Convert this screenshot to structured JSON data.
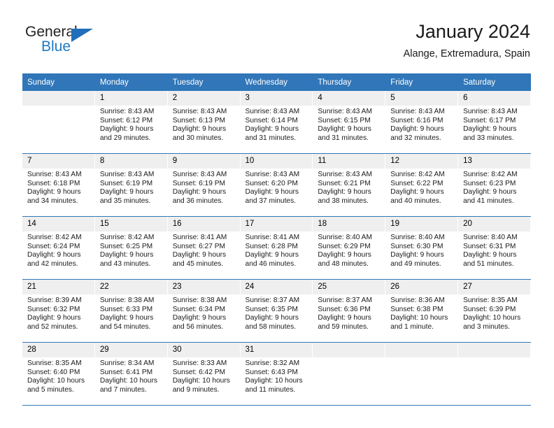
{
  "logo": {
    "word_top": "General",
    "word_bottom": "Blue",
    "triangle_color": "#1f6fba",
    "blue_color": "#1f7ac4"
  },
  "header": {
    "title": "January 2024",
    "location": "Alange, Extremadura, Spain"
  },
  "theme": {
    "header_bg": "#3076b8",
    "daynum_bg": "#efefef",
    "text": "#1a1a1a"
  },
  "weekdays": [
    "Sunday",
    "Monday",
    "Tuesday",
    "Wednesday",
    "Thursday",
    "Friday",
    "Saturday"
  ],
  "weeks": [
    [
      {
        "day": "",
        "sunrise": "",
        "sunset": "",
        "daylight1": "",
        "daylight2": ""
      },
      {
        "day": "1",
        "sunrise": "Sunrise: 8:43 AM",
        "sunset": "Sunset: 6:12 PM",
        "daylight1": "Daylight: 9 hours",
        "daylight2": "and 29 minutes."
      },
      {
        "day": "2",
        "sunrise": "Sunrise: 8:43 AM",
        "sunset": "Sunset: 6:13 PM",
        "daylight1": "Daylight: 9 hours",
        "daylight2": "and 30 minutes."
      },
      {
        "day": "3",
        "sunrise": "Sunrise: 8:43 AM",
        "sunset": "Sunset: 6:14 PM",
        "daylight1": "Daylight: 9 hours",
        "daylight2": "and 31 minutes."
      },
      {
        "day": "4",
        "sunrise": "Sunrise: 8:43 AM",
        "sunset": "Sunset: 6:15 PM",
        "daylight1": "Daylight: 9 hours",
        "daylight2": "and 31 minutes."
      },
      {
        "day": "5",
        "sunrise": "Sunrise: 8:43 AM",
        "sunset": "Sunset: 6:16 PM",
        "daylight1": "Daylight: 9 hours",
        "daylight2": "and 32 minutes."
      },
      {
        "day": "6",
        "sunrise": "Sunrise: 8:43 AM",
        "sunset": "Sunset: 6:17 PM",
        "daylight1": "Daylight: 9 hours",
        "daylight2": "and 33 minutes."
      }
    ],
    [
      {
        "day": "7",
        "sunrise": "Sunrise: 8:43 AM",
        "sunset": "Sunset: 6:18 PM",
        "daylight1": "Daylight: 9 hours",
        "daylight2": "and 34 minutes."
      },
      {
        "day": "8",
        "sunrise": "Sunrise: 8:43 AM",
        "sunset": "Sunset: 6:19 PM",
        "daylight1": "Daylight: 9 hours",
        "daylight2": "and 35 minutes."
      },
      {
        "day": "9",
        "sunrise": "Sunrise: 8:43 AM",
        "sunset": "Sunset: 6:19 PM",
        "daylight1": "Daylight: 9 hours",
        "daylight2": "and 36 minutes."
      },
      {
        "day": "10",
        "sunrise": "Sunrise: 8:43 AM",
        "sunset": "Sunset: 6:20 PM",
        "daylight1": "Daylight: 9 hours",
        "daylight2": "and 37 minutes."
      },
      {
        "day": "11",
        "sunrise": "Sunrise: 8:43 AM",
        "sunset": "Sunset: 6:21 PM",
        "daylight1": "Daylight: 9 hours",
        "daylight2": "and 38 minutes."
      },
      {
        "day": "12",
        "sunrise": "Sunrise: 8:42 AM",
        "sunset": "Sunset: 6:22 PM",
        "daylight1": "Daylight: 9 hours",
        "daylight2": "and 40 minutes."
      },
      {
        "day": "13",
        "sunrise": "Sunrise: 8:42 AM",
        "sunset": "Sunset: 6:23 PM",
        "daylight1": "Daylight: 9 hours",
        "daylight2": "and 41 minutes."
      }
    ],
    [
      {
        "day": "14",
        "sunrise": "Sunrise: 8:42 AM",
        "sunset": "Sunset: 6:24 PM",
        "daylight1": "Daylight: 9 hours",
        "daylight2": "and 42 minutes."
      },
      {
        "day": "15",
        "sunrise": "Sunrise: 8:42 AM",
        "sunset": "Sunset: 6:25 PM",
        "daylight1": "Daylight: 9 hours",
        "daylight2": "and 43 minutes."
      },
      {
        "day": "16",
        "sunrise": "Sunrise: 8:41 AM",
        "sunset": "Sunset: 6:27 PM",
        "daylight1": "Daylight: 9 hours",
        "daylight2": "and 45 minutes."
      },
      {
        "day": "17",
        "sunrise": "Sunrise: 8:41 AM",
        "sunset": "Sunset: 6:28 PM",
        "daylight1": "Daylight: 9 hours",
        "daylight2": "and 46 minutes."
      },
      {
        "day": "18",
        "sunrise": "Sunrise: 8:40 AM",
        "sunset": "Sunset: 6:29 PM",
        "daylight1": "Daylight: 9 hours",
        "daylight2": "and 48 minutes."
      },
      {
        "day": "19",
        "sunrise": "Sunrise: 8:40 AM",
        "sunset": "Sunset: 6:30 PM",
        "daylight1": "Daylight: 9 hours",
        "daylight2": "and 49 minutes."
      },
      {
        "day": "20",
        "sunrise": "Sunrise: 8:40 AM",
        "sunset": "Sunset: 6:31 PM",
        "daylight1": "Daylight: 9 hours",
        "daylight2": "and 51 minutes."
      }
    ],
    [
      {
        "day": "21",
        "sunrise": "Sunrise: 8:39 AM",
        "sunset": "Sunset: 6:32 PM",
        "daylight1": "Daylight: 9 hours",
        "daylight2": "and 52 minutes."
      },
      {
        "day": "22",
        "sunrise": "Sunrise: 8:38 AM",
        "sunset": "Sunset: 6:33 PM",
        "daylight1": "Daylight: 9 hours",
        "daylight2": "and 54 minutes."
      },
      {
        "day": "23",
        "sunrise": "Sunrise: 8:38 AM",
        "sunset": "Sunset: 6:34 PM",
        "daylight1": "Daylight: 9 hours",
        "daylight2": "and 56 minutes."
      },
      {
        "day": "24",
        "sunrise": "Sunrise: 8:37 AM",
        "sunset": "Sunset: 6:35 PM",
        "daylight1": "Daylight: 9 hours",
        "daylight2": "and 58 minutes."
      },
      {
        "day": "25",
        "sunrise": "Sunrise: 8:37 AM",
        "sunset": "Sunset: 6:36 PM",
        "daylight1": "Daylight: 9 hours",
        "daylight2": "and 59 minutes."
      },
      {
        "day": "26",
        "sunrise": "Sunrise: 8:36 AM",
        "sunset": "Sunset: 6:38 PM",
        "daylight1": "Daylight: 10 hours",
        "daylight2": "and 1 minute."
      },
      {
        "day": "27",
        "sunrise": "Sunrise: 8:35 AM",
        "sunset": "Sunset: 6:39 PM",
        "daylight1": "Daylight: 10 hours",
        "daylight2": "and 3 minutes."
      }
    ],
    [
      {
        "day": "28",
        "sunrise": "Sunrise: 8:35 AM",
        "sunset": "Sunset: 6:40 PM",
        "daylight1": "Daylight: 10 hours",
        "daylight2": "and 5 minutes."
      },
      {
        "day": "29",
        "sunrise": "Sunrise: 8:34 AM",
        "sunset": "Sunset: 6:41 PM",
        "daylight1": "Daylight: 10 hours",
        "daylight2": "and 7 minutes."
      },
      {
        "day": "30",
        "sunrise": "Sunrise: 8:33 AM",
        "sunset": "Sunset: 6:42 PM",
        "daylight1": "Daylight: 10 hours",
        "daylight2": "and 9 minutes."
      },
      {
        "day": "31",
        "sunrise": "Sunrise: 8:32 AM",
        "sunset": "Sunset: 6:43 PM",
        "daylight1": "Daylight: 10 hours",
        "daylight2": "and 11 minutes."
      },
      {
        "day": "",
        "sunrise": "",
        "sunset": "",
        "daylight1": "",
        "daylight2": ""
      },
      {
        "day": "",
        "sunrise": "",
        "sunset": "",
        "daylight1": "",
        "daylight2": ""
      },
      {
        "day": "",
        "sunrise": "",
        "sunset": "",
        "daylight1": "",
        "daylight2": ""
      }
    ]
  ]
}
